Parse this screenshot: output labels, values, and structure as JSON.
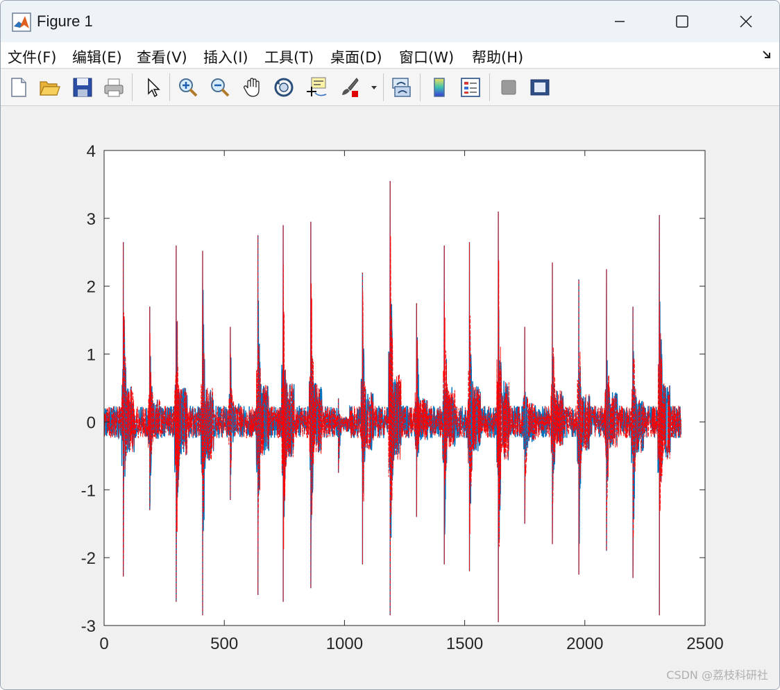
{
  "window": {
    "title": "Figure 1",
    "controls": {
      "minimize": "minimize",
      "maximize": "maximize",
      "close": "close"
    }
  },
  "menu": [
    {
      "label": "文件(F)"
    },
    {
      "label": "编辑(E)"
    },
    {
      "label": "查看(V)"
    },
    {
      "label": "插入(I)"
    },
    {
      "label": "工具(T)"
    },
    {
      "label": "桌面(D)"
    },
    {
      "label": "窗口(W)"
    },
    {
      "label": "帮助(H)"
    }
  ],
  "toolbar": [
    {
      "icon": "new-figure-icon"
    },
    {
      "icon": "open-file-icon"
    },
    {
      "icon": "save-icon"
    },
    {
      "icon": "print-icon"
    },
    {
      "icon": "edit-plot-cursor-icon"
    },
    {
      "icon": "zoom-in-icon"
    },
    {
      "icon": "zoom-out-icon"
    },
    {
      "icon": "pan-hand-icon"
    },
    {
      "icon": "rotate-3d-icon"
    },
    {
      "icon": "data-cursor-icon"
    },
    {
      "icon": "brush-icon"
    },
    {
      "icon": "dropdown-arrow-icon"
    },
    {
      "icon": "link-plot-icon"
    },
    {
      "icon": "colorbar-icon"
    },
    {
      "icon": "legend-icon"
    },
    {
      "icon": "hide-plot-tools-icon"
    },
    {
      "icon": "show-plot-tools-icon"
    }
  ],
  "colors": {
    "series_blue": "#0072bd",
    "series_red": "#ff0000",
    "axes_bg": "#ffffff",
    "figure_bg": "#f0f0f0"
  },
  "chart_data": {
    "type": "line",
    "title": "",
    "xlabel": "",
    "ylabel": "",
    "xlim": [
      0,
      2500
    ],
    "ylim": [
      -3,
      4
    ],
    "xticks": [
      "0",
      "500",
      "1000",
      "1500",
      "2000",
      "2500"
    ],
    "yticks": [
      "-3",
      "-2",
      "-1",
      "0",
      "1",
      "2",
      "3",
      "4"
    ],
    "grid": false,
    "legend": "none",
    "x_extent": [
      1,
      2400
    ],
    "series": [
      {
        "style": "solid",
        "color": "#0072bd",
        "baseline_amplitude": 0.2
      },
      {
        "style": "dashed",
        "color": "#ff0000",
        "baseline_amplitude": 0.2
      }
    ],
    "peaks": [
      {
        "x": 80,
        "max": 2.65,
        "min": -2.28
      },
      {
        "x": 190,
        "max": 1.7,
        "min": -1.3
      },
      {
        "x": 300,
        "max": 2.6,
        "min": -2.65
      },
      {
        "x": 410,
        "max": 2.52,
        "min": -2.85
      },
      {
        "x": 525,
        "max": 1.4,
        "min": -1.15
      },
      {
        "x": 640,
        "max": 2.75,
        "min": -2.55
      },
      {
        "x": 745,
        "max": 2.9,
        "min": -2.65
      },
      {
        "x": 860,
        "max": 2.95,
        "min": -2.45
      },
      {
        "x": 975,
        "max": 0.35,
        "min": -0.75
      },
      {
        "x": 1075,
        "max": 2.2,
        "min": -2.1
      },
      {
        "x": 1190,
        "max": 3.55,
        "min": -2.85
      },
      {
        "x": 1300,
        "max": 1.75,
        "min": -1.4
      },
      {
        "x": 1415,
        "max": 2.6,
        "min": -2.1
      },
      {
        "x": 1520,
        "max": 2.65,
        "min": -2.2
      },
      {
        "x": 1640,
        "max": 3.1,
        "min": -2.95
      },
      {
        "x": 1750,
        "max": 1.4,
        "min": -1.5
      },
      {
        "x": 1865,
        "max": 2.35,
        "min": -1.8
      },
      {
        "x": 1975,
        "max": 2.1,
        "min": -2.25
      },
      {
        "x": 2090,
        "max": 2.25,
        "min": -1.9
      },
      {
        "x": 2200,
        "max": 1.7,
        "min": -2.3
      },
      {
        "x": 2310,
        "max": 3.05,
        "min": -2.85
      }
    ]
  },
  "watermark": "CSDN @荔枝科研社"
}
